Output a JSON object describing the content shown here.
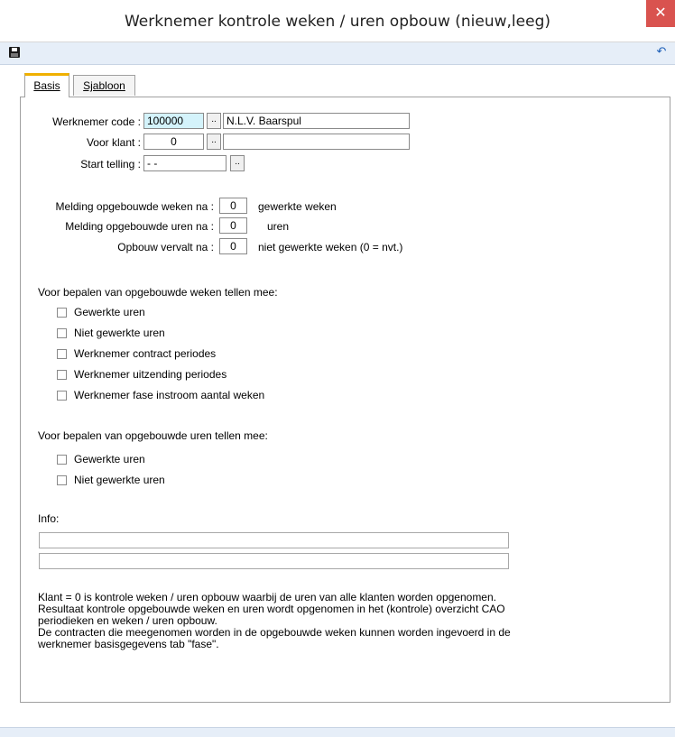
{
  "window": {
    "title": "Werknemer kontrole weken / uren opbouw  (nieuw,leeg)",
    "close_glyph": "✕"
  },
  "toolbar": {
    "save_icon": "save-icon",
    "undo_icon": "undo-icon",
    "undo_glyph": "↶"
  },
  "tabs": [
    {
      "label": "Basis",
      "active": true
    },
    {
      "label": "Sjabloon",
      "active": false
    }
  ],
  "form": {
    "werknemer_code": {
      "label": "Werknemer code :",
      "value": "100000",
      "lookup": "..",
      "name": "N.L.V. Baarspul"
    },
    "voor_klant": {
      "label": "Voor klant :",
      "value": "0",
      "lookup": "..",
      "name": ""
    },
    "start_telling": {
      "label": "Start telling :",
      "value": " -  - ",
      "lookup": ".."
    },
    "melding_weken": {
      "label": "Melding opgebouwde weken na :",
      "value": "0",
      "suffix": "gewerkte weken"
    },
    "melding_uren": {
      "label": "Melding opgebouwde uren na :",
      "value": "0",
      "suffix": "uren"
    },
    "opbouw_vervalt": {
      "label": "Opbouw vervalt na :",
      "value": "0",
      "suffix": "niet gewerkte weken (0 = nvt.)"
    }
  },
  "weken_section": {
    "heading": "Voor bepalen van opgebouwde weken tellen mee:",
    "items": [
      {
        "label": "Gewerkte uren",
        "checked": false
      },
      {
        "label": "Niet gewerkte uren",
        "checked": false
      },
      {
        "label": "Werknemer contract periodes",
        "checked": false
      },
      {
        "label": "Werknemer uitzending periodes",
        "checked": false
      },
      {
        "label": "Werknemer fase instroom aantal weken",
        "checked": false
      }
    ]
  },
  "uren_section": {
    "heading": "Voor bepalen van opgebouwde uren tellen mee:",
    "items": [
      {
        "label": "Gewerkte uren",
        "checked": false
      },
      {
        "label": "Niet gewerkte uren",
        "checked": false
      }
    ]
  },
  "info": {
    "label": "Info:",
    "line1": "",
    "line2": ""
  },
  "note": {
    "lines": [
      "Klant = 0 is kontrole weken / uren opbouw waarbij de uren van alle klanten worden opgenomen.",
      "Resultaat kontrole opgebouwde weken en uren wordt opgenomen in het (kontrole) overzicht CAO",
      "periodieken en weken / uren opbouw.",
      "De contracten die meegenomen worden in de opgebouwde weken kunnen worden ingevoerd in de",
      "werknemer basisgegevens tab \"fase\"."
    ]
  }
}
